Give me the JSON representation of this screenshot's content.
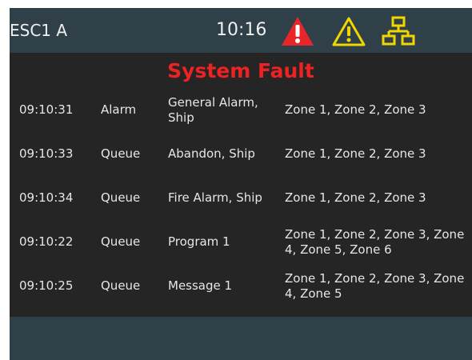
{
  "header": {
    "station": "ESC1 A",
    "time": "10:16",
    "icons": {
      "alarm": "alarm-triangle-icon",
      "warning": "warning-triangle-icon",
      "network": "network-icon"
    },
    "colors": {
      "alarm": "#e8262a",
      "warning": "#f1d600",
      "network": "#f1d600"
    }
  },
  "status": {
    "title": "System Fault",
    "color": "#ee2222"
  },
  "events": [
    {
      "time": "09:10:31",
      "type": "Alarm",
      "description": "General Alarm, Ship",
      "zones": "Zone 1, Zone 2, Zone 3"
    },
    {
      "time": "09:10:33",
      "type": "Queue",
      "description": "Abandon, Ship",
      "zones": "Zone 1, Zone 2, Zone 3"
    },
    {
      "time": "09:10:34",
      "type": "Queue",
      "description": "Fire Alarm, Ship",
      "zones": "Zone 1, Zone 2, Zone 3"
    },
    {
      "time": "09:10:22",
      "type": "Queue",
      "description": "Program 1",
      "zones": "Zone 1, Zone 2, Zone 3, Zone 4, Zone 5, Zone 6"
    },
    {
      "time": "09:10:25",
      "type": "Queue",
      "description": "Message 1",
      "zones": "Zone 1, Zone 2, Zone 3, Zone 4, Zone 5"
    }
  ]
}
